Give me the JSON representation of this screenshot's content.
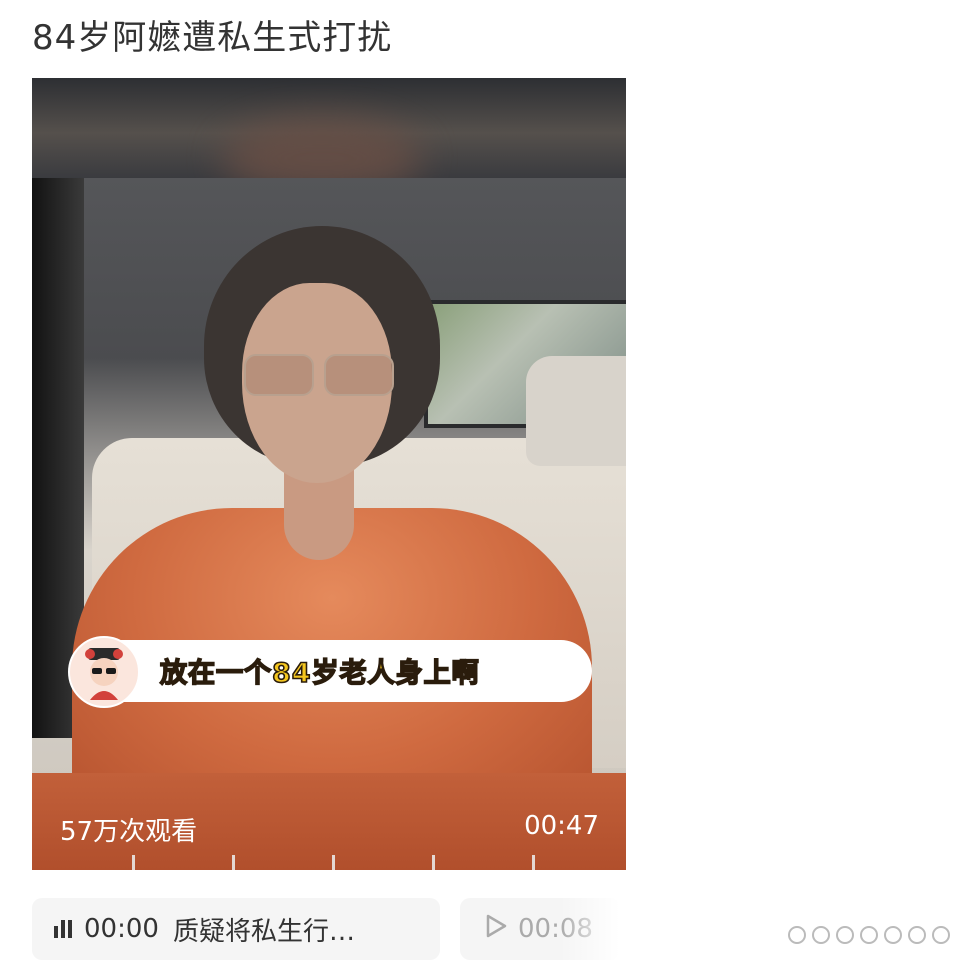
{
  "post": {
    "title": "84岁阿嬷遭私生式打扰"
  },
  "video": {
    "caption": "放在一个84岁老人身上啊",
    "view_count": "57万次观看",
    "duration": "00:47"
  },
  "chips": [
    {
      "icon": "audio-bars-icon",
      "time": "00:00",
      "text": "质疑将私生行…"
    },
    {
      "icon": "play-icon",
      "time": "00:08",
      "text": ""
    }
  ],
  "colors": {
    "caption_text": "#f4c61f",
    "video_bottom": "#b9552f",
    "chip_bg": "#f5f5f5"
  }
}
